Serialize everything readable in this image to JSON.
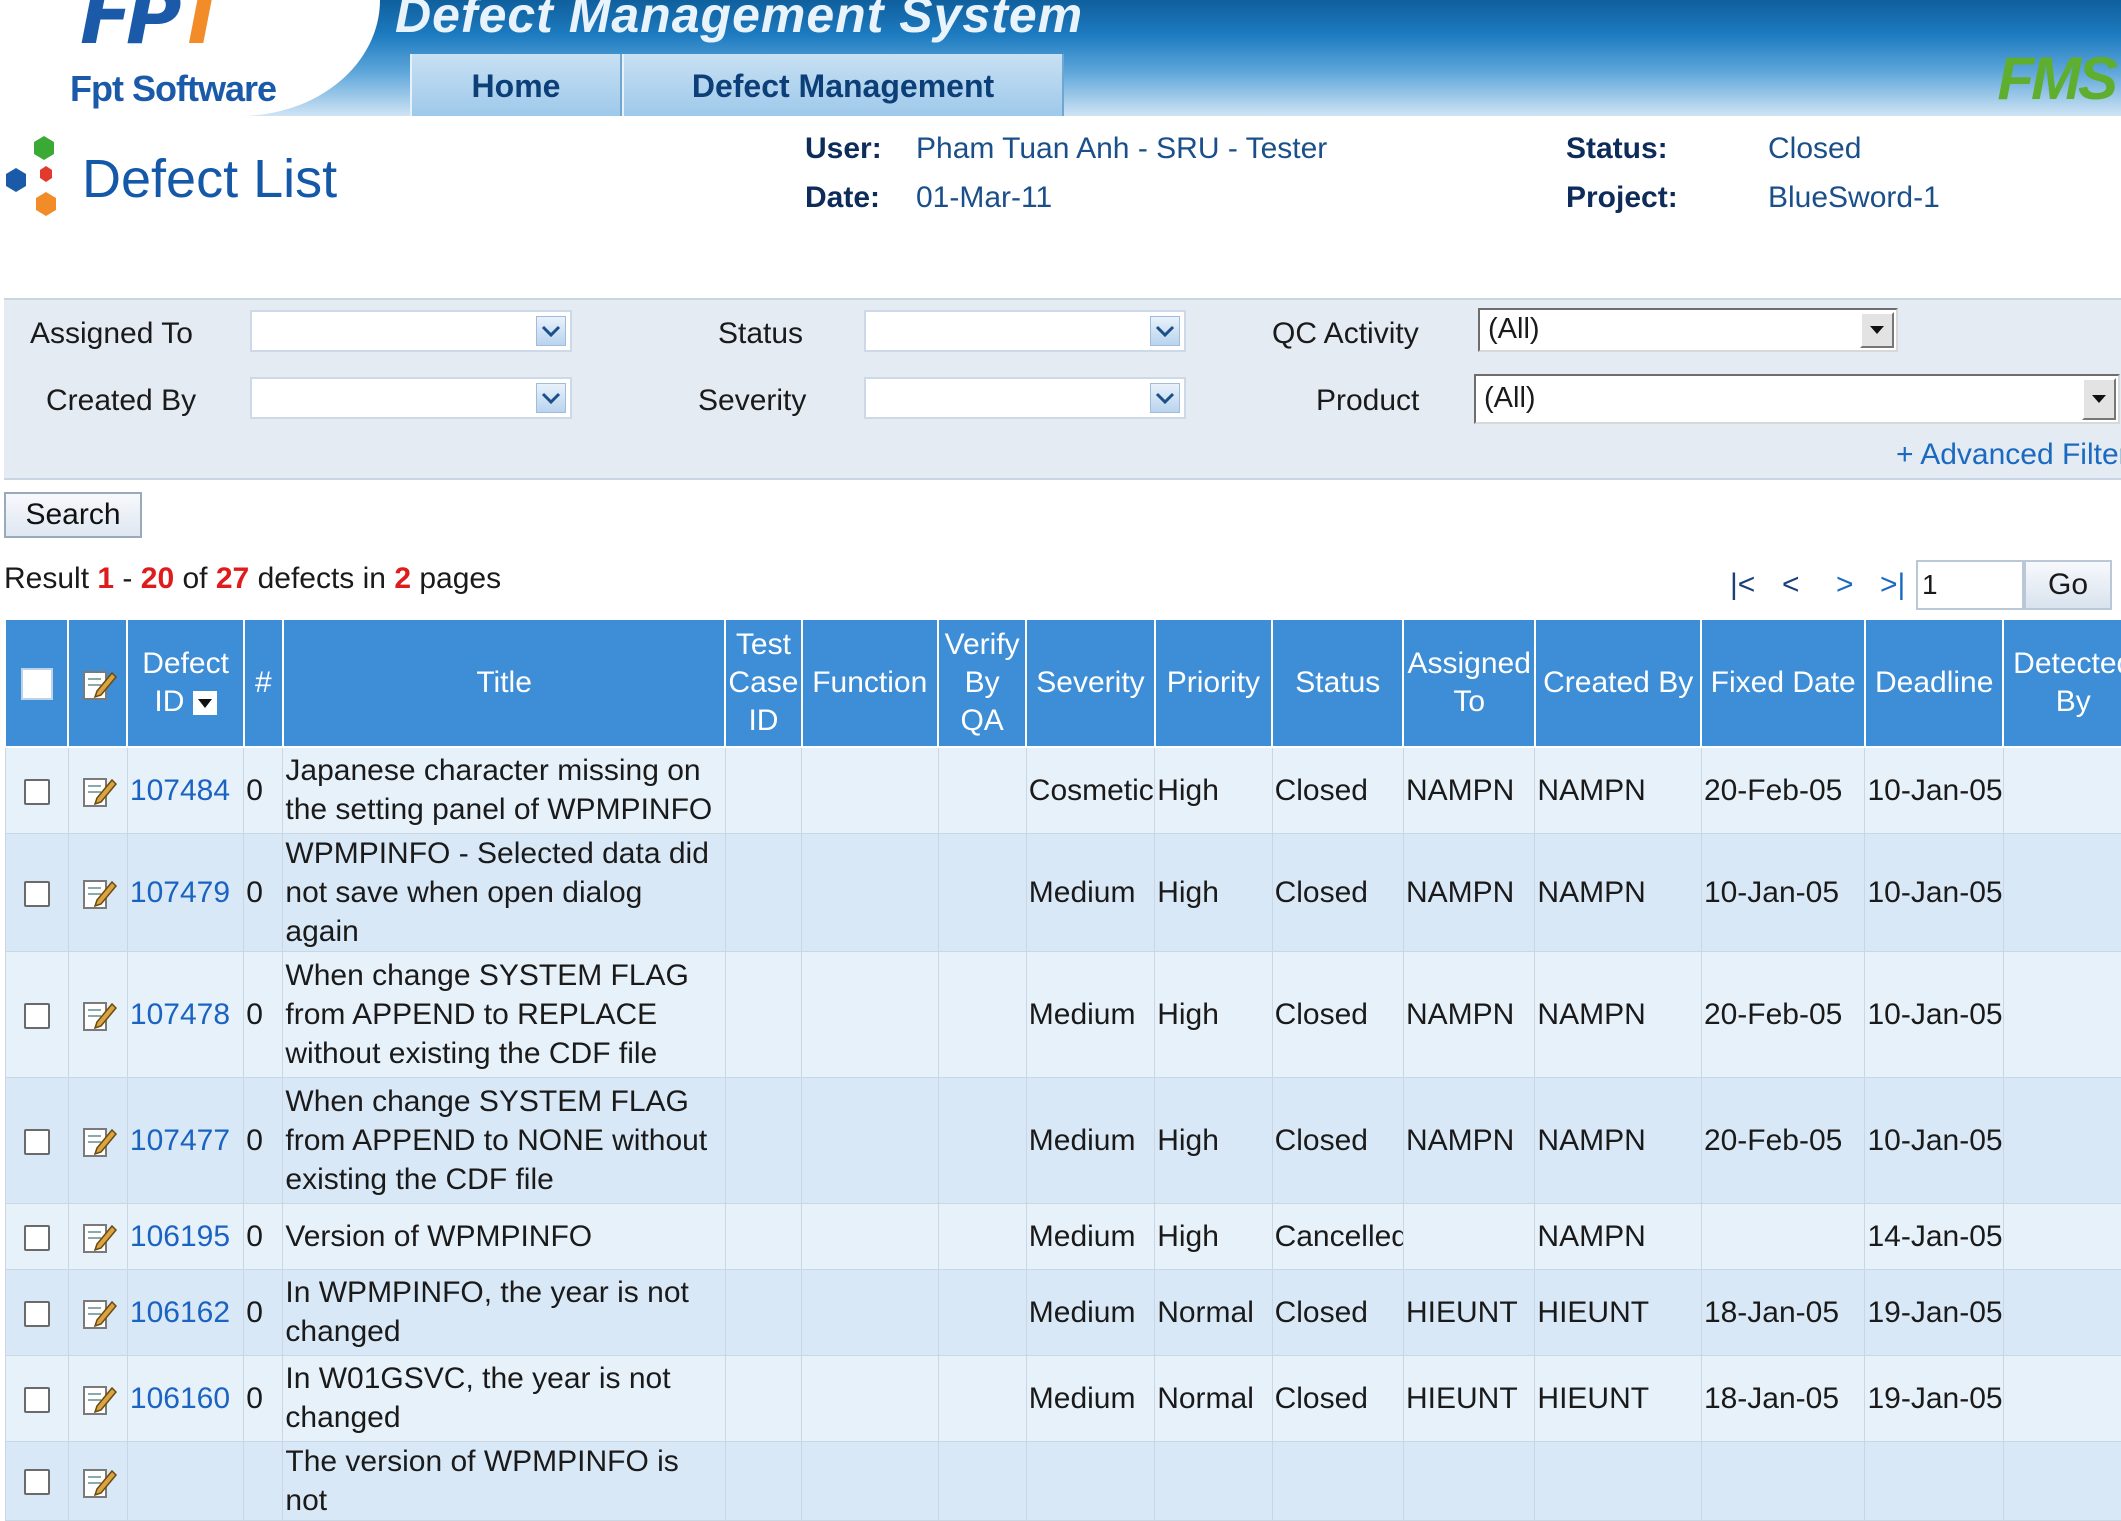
{
  "header": {
    "logo_text": "Fpt Software",
    "app_title": "Defect Management System",
    "nav": [
      {
        "label": "Home"
      },
      {
        "label": "Defect Management"
      }
    ],
    "brand": "FMS"
  },
  "page": {
    "title": "Defect List",
    "user_label": "User:",
    "user_value": "Pham Tuan Anh - SRU - Tester",
    "date_label": "Date:",
    "date_value": "01-Mar-11",
    "status_label": "Status:",
    "status_value": "Closed",
    "project_label": "Project:",
    "project_value": "BlueSword-1"
  },
  "filter": {
    "assigned_to_label": "Assigned To",
    "assigned_to_value": "",
    "created_by_label": "Created By",
    "created_by_value": "",
    "status_label": "Status",
    "status_value": "",
    "severity_label": "Severity",
    "severity_value": "",
    "qc_activity_label": "QC Activity",
    "qc_activity_value": "(All)",
    "product_label": "Product",
    "product_value": "(All)",
    "advanced_label": "+ Advanced Filter",
    "search_label": "Search"
  },
  "result": {
    "prefix": "Result",
    "from": "1",
    "dash": "-",
    "to": "20",
    "of": "of",
    "total": "27",
    "defects_in": "defects in",
    "pages": "2",
    "pages_word": "pages"
  },
  "pager": {
    "first": "|<",
    "prev": "<",
    "next": ">",
    "last": ">|",
    "page_value": "1",
    "go_label": "Go"
  },
  "table": {
    "columns": [
      "Defect ID",
      "#",
      "Title",
      "Test Case ID",
      "Function",
      "Verify By QA",
      "Severity",
      "Priority",
      "Status",
      "Assigned To",
      "Created By",
      "Fixed Date",
      "Deadline",
      "Detected By"
    ],
    "rows": [
      {
        "id": "107484",
        "num": "0",
        "title": "Japanese character missing on the setting panel of WPMPINFO",
        "test_case": "",
        "function": "",
        "verify": "",
        "severity": "Cosmetic",
        "priority": "High",
        "status": "Closed",
        "assigned": "NAMPN",
        "created": "NAMPN",
        "fixed": "20-Feb-05",
        "deadline": "10-Jan-05",
        "detected": ""
      },
      {
        "id": "107479",
        "num": "0",
        "title": "WPMPINFO - Selected data did not save when open dialog again",
        "test_case": "",
        "function": "",
        "verify": "",
        "severity": "Medium",
        "priority": "High",
        "status": "Closed",
        "assigned": "NAMPN",
        "created": "NAMPN",
        "fixed": "10-Jan-05",
        "deadline": "10-Jan-05",
        "detected": ""
      },
      {
        "id": "107478",
        "num": "0",
        "title": "When change SYSTEM FLAG from APPEND to REPLACE without existing the CDF file",
        "test_case": "",
        "function": "",
        "verify": "",
        "severity": "Medium",
        "priority": "High",
        "status": "Closed",
        "assigned": "NAMPN",
        "created": "NAMPN",
        "fixed": "20-Feb-05",
        "deadline": "10-Jan-05",
        "detected": ""
      },
      {
        "id": "107477",
        "num": "0",
        "title": "When change SYSTEM FLAG from APPEND to NONE without existing the CDF file",
        "test_case": "",
        "function": "",
        "verify": "",
        "severity": "Medium",
        "priority": "High",
        "status": "Closed",
        "assigned": "NAMPN",
        "created": "NAMPN",
        "fixed": "20-Feb-05",
        "deadline": "10-Jan-05",
        "detected": ""
      },
      {
        "id": "106195",
        "num": "0",
        "title": "Version of WPMPINFO",
        "test_case": "",
        "function": "",
        "verify": "",
        "severity": "Medium",
        "priority": "High",
        "status": "Cancelled",
        "assigned": "",
        "created": "NAMPN",
        "fixed": "",
        "deadline": "14-Jan-05",
        "detected": ""
      },
      {
        "id": "106162",
        "num": "0",
        "title": "In WPMPINFO, the year is not changed",
        "test_case": "",
        "function": "",
        "verify": "",
        "severity": "Medium",
        "priority": "Normal",
        "status": "Closed",
        "assigned": "HIEUNT",
        "created": "HIEUNT",
        "fixed": "18-Jan-05",
        "deadline": "19-Jan-05",
        "detected": ""
      },
      {
        "id": "106160",
        "num": "0",
        "title": "In W01GSVC, the year is not changed",
        "test_case": "",
        "function": "",
        "verify": "",
        "severity": "Medium",
        "priority": "Normal",
        "status": "Closed",
        "assigned": "HIEUNT",
        "created": "HIEUNT",
        "fixed": "18-Jan-05",
        "deadline": "19-Jan-05",
        "detected": ""
      },
      {
        "id": "",
        "num": "",
        "title": "The version of WPMPINFO is not",
        "test_case": "",
        "function": "",
        "verify": "",
        "severity": "",
        "priority": "",
        "status": "",
        "assigned": "",
        "created": "",
        "fixed": "",
        "deadline": "",
        "detected": ""
      }
    ]
  }
}
